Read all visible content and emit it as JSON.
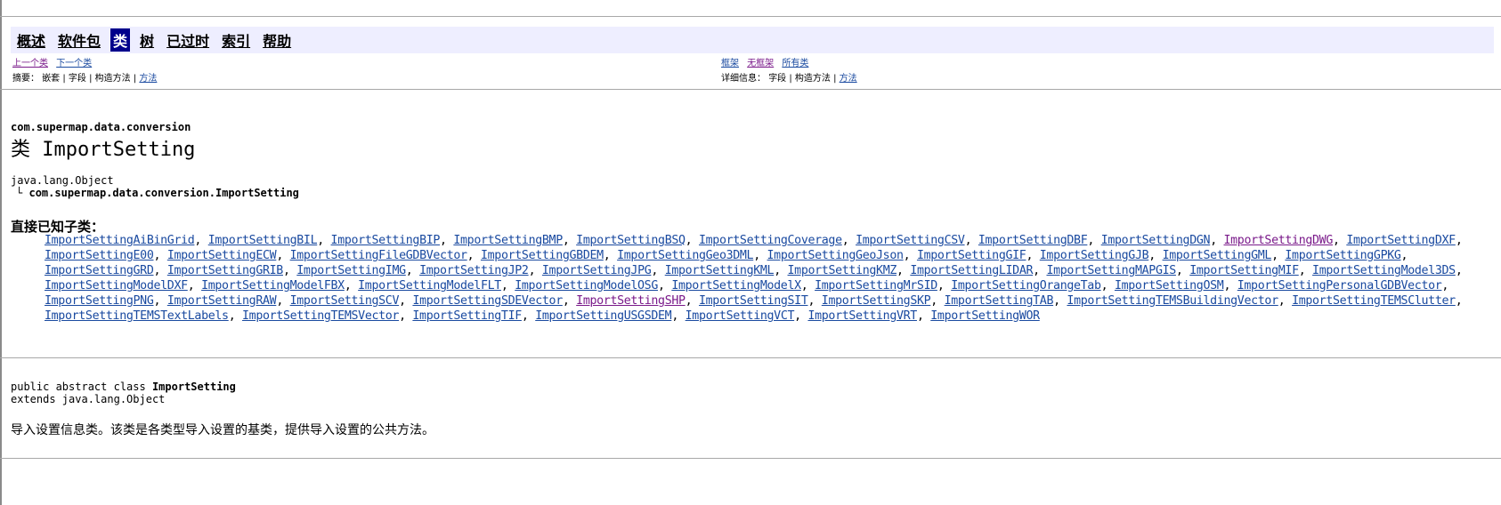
{
  "navbar": {
    "items": [
      {
        "label": "概述",
        "current": false,
        "link": true
      },
      {
        "label": "软件包",
        "current": false,
        "link": true
      },
      {
        "label": "类",
        "current": true,
        "link": false
      },
      {
        "label": "树",
        "current": false,
        "link": true
      },
      {
        "label": "已过时",
        "current": false,
        "link": true
      },
      {
        "label": "索引",
        "current": false,
        "link": true
      },
      {
        "label": "帮助",
        "current": false,
        "link": true
      }
    ]
  },
  "subnav": {
    "prev_class": "上一个类",
    "next_class": "下一个类",
    "frames": "框架",
    "no_frames": "无框架",
    "all_classes": "所有类",
    "summary_prefix": "摘要：",
    "summary_items": "嵌套 | 字段 | 构造方法 |",
    "summary_method": "方法",
    "detail_prefix": "详细信息：",
    "detail_items": "字段 | 构造方法 |",
    "detail_method": "方法"
  },
  "header": {
    "package": "com.supermap.data.conversion",
    "title": "类 ImportSetting",
    "inherit_root": "java.lang.Object",
    "inherit_child": "com.supermap.data.conversion.ImportSetting",
    "inherit_connector": "└"
  },
  "subclasses": {
    "heading": "直接已知子类：",
    "items": [
      {
        "name": "ImportSettingAiBinGrid"
      },
      {
        "name": "ImportSettingBIL"
      },
      {
        "name": "ImportSettingBIP"
      },
      {
        "name": "ImportSettingBMP"
      },
      {
        "name": "ImportSettingBSQ"
      },
      {
        "name": "ImportSettingCoverage"
      },
      {
        "name": "ImportSettingCSV"
      },
      {
        "name": "ImportSettingDBF"
      },
      {
        "name": "ImportSettingDGN"
      },
      {
        "name": "ImportSettingDWG",
        "visited": true
      },
      {
        "name": "ImportSettingDXF"
      },
      {
        "name": "ImportSettingE00"
      },
      {
        "name": "ImportSettingECW"
      },
      {
        "name": "ImportSettingFileGDBVector"
      },
      {
        "name": "ImportSettingGBDEM"
      },
      {
        "name": "ImportSettingGeo3DML"
      },
      {
        "name": "ImportSettingGeoJson"
      },
      {
        "name": "ImportSettingGIF"
      },
      {
        "name": "ImportSettingGJB"
      },
      {
        "name": "ImportSettingGML"
      },
      {
        "name": "ImportSettingGPKG"
      },
      {
        "name": "ImportSettingGRD"
      },
      {
        "name": "ImportSettingGRIB"
      },
      {
        "name": "ImportSettingIMG"
      },
      {
        "name": "ImportSettingJP2"
      },
      {
        "name": "ImportSettingJPG"
      },
      {
        "name": "ImportSettingKML"
      },
      {
        "name": "ImportSettingKMZ"
      },
      {
        "name": "ImportSettingLIDAR"
      },
      {
        "name": "ImportSettingMAPGIS"
      },
      {
        "name": "ImportSettingMIF"
      },
      {
        "name": "ImportSettingModel3DS"
      },
      {
        "name": "ImportSettingModelDXF"
      },
      {
        "name": "ImportSettingModelFBX"
      },
      {
        "name": "ImportSettingModelFLT"
      },
      {
        "name": "ImportSettingModelOSG"
      },
      {
        "name": "ImportSettingModelX"
      },
      {
        "name": "ImportSettingMrSID"
      },
      {
        "name": "ImportSettingOrangeTab"
      },
      {
        "name": "ImportSettingOSM"
      },
      {
        "name": "ImportSettingPersonalGDBVector"
      },
      {
        "name": "ImportSettingPNG"
      },
      {
        "name": "ImportSettingRAW"
      },
      {
        "name": "ImportSettingSCV"
      },
      {
        "name": "ImportSettingSDEVector"
      },
      {
        "name": "ImportSettingSHP",
        "visited": true
      },
      {
        "name": "ImportSettingSIT"
      },
      {
        "name": "ImportSettingSKP"
      },
      {
        "name": "ImportSettingTAB"
      },
      {
        "name": "ImportSettingTEMSBuildingVector"
      },
      {
        "name": "ImportSettingTEMSClutter"
      },
      {
        "name": "ImportSettingTEMSTextLabels"
      },
      {
        "name": "ImportSettingTEMSVector"
      },
      {
        "name": "ImportSettingTIF"
      },
      {
        "name": "ImportSettingUSGSDEM"
      },
      {
        "name": "ImportSettingVCT"
      },
      {
        "name": "ImportSettingVRT"
      },
      {
        "name": "ImportSettingWOR"
      }
    ]
  },
  "declaration": {
    "line1_prefix": "public abstract class ",
    "line1_name": "ImportSetting",
    "line2": "extends java.lang.Object"
  },
  "description": "导入设置信息类。该类是各类型导入设置的基类，提供导入设置的公共方法。",
  "colors": {
    "link": "#1a4aa0",
    "visited_link": "#7a1a8a",
    "navbar_bg": "#eeeeff",
    "nav_current_bg": "#00008b"
  }
}
